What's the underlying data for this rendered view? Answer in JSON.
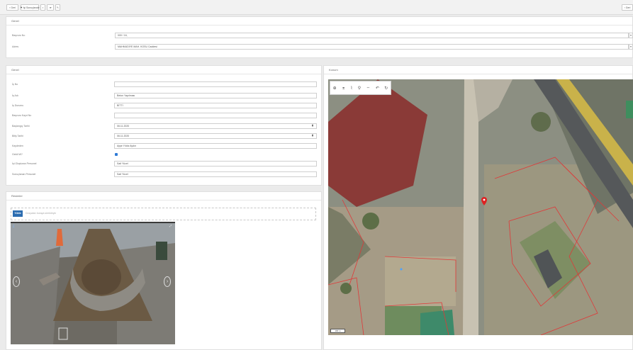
{
  "toolbar": {
    "back_label": "Geri",
    "status_label": "İşi Sonuçlandır",
    "save_icon": "save-icon",
    "print_icon": "print-icon",
    "edit_icon": "pencil-icon",
    "right_label": "Geri"
  },
  "top_panel": {
    "title": "Genel",
    "fields": [
      {
        "label": "Başvuru No",
        "value": "000 / 16,"
      },
      {
        "label": "Adres",
        "value": "MAHMUDİYE MAH. KOSU Caddesi"
      }
    ]
  },
  "detail_panel": {
    "title": "Genel",
    "fields": [
      {
        "label": "İş No",
        "value": ""
      },
      {
        "label": "İş Adı",
        "value": "Beton Yapılması"
      },
      {
        "label": "İş Durumu",
        "value": "BİTTİ"
      },
      {
        "label": "Başvuru Kayıt No",
        "value": ""
      },
      {
        "label": "Başlangıç Tarihi",
        "value": "06.11.2020"
      },
      {
        "label": "Bitiş Tarihi",
        "value": "06.11.2020"
      },
      {
        "label": "Kaydeden",
        "value": "Ayşe Yıldız Aydın"
      },
      {
        "label": "Geldi Mi?",
        "value": ""
      },
      {
        "label": "İşi Oluşturan Personel",
        "value": "Sait Yücel"
      },
      {
        "label": "Sonuçlanan Personel",
        "value": "Sait Yücel"
      }
    ]
  },
  "photos_panel": {
    "title": "Resimler",
    "upload_button": "Yükle",
    "upload_hint": "Dosyaları buraya sürükleyin"
  },
  "map_panel": {
    "title": "Konum",
    "scale_label": "100 m"
  }
}
